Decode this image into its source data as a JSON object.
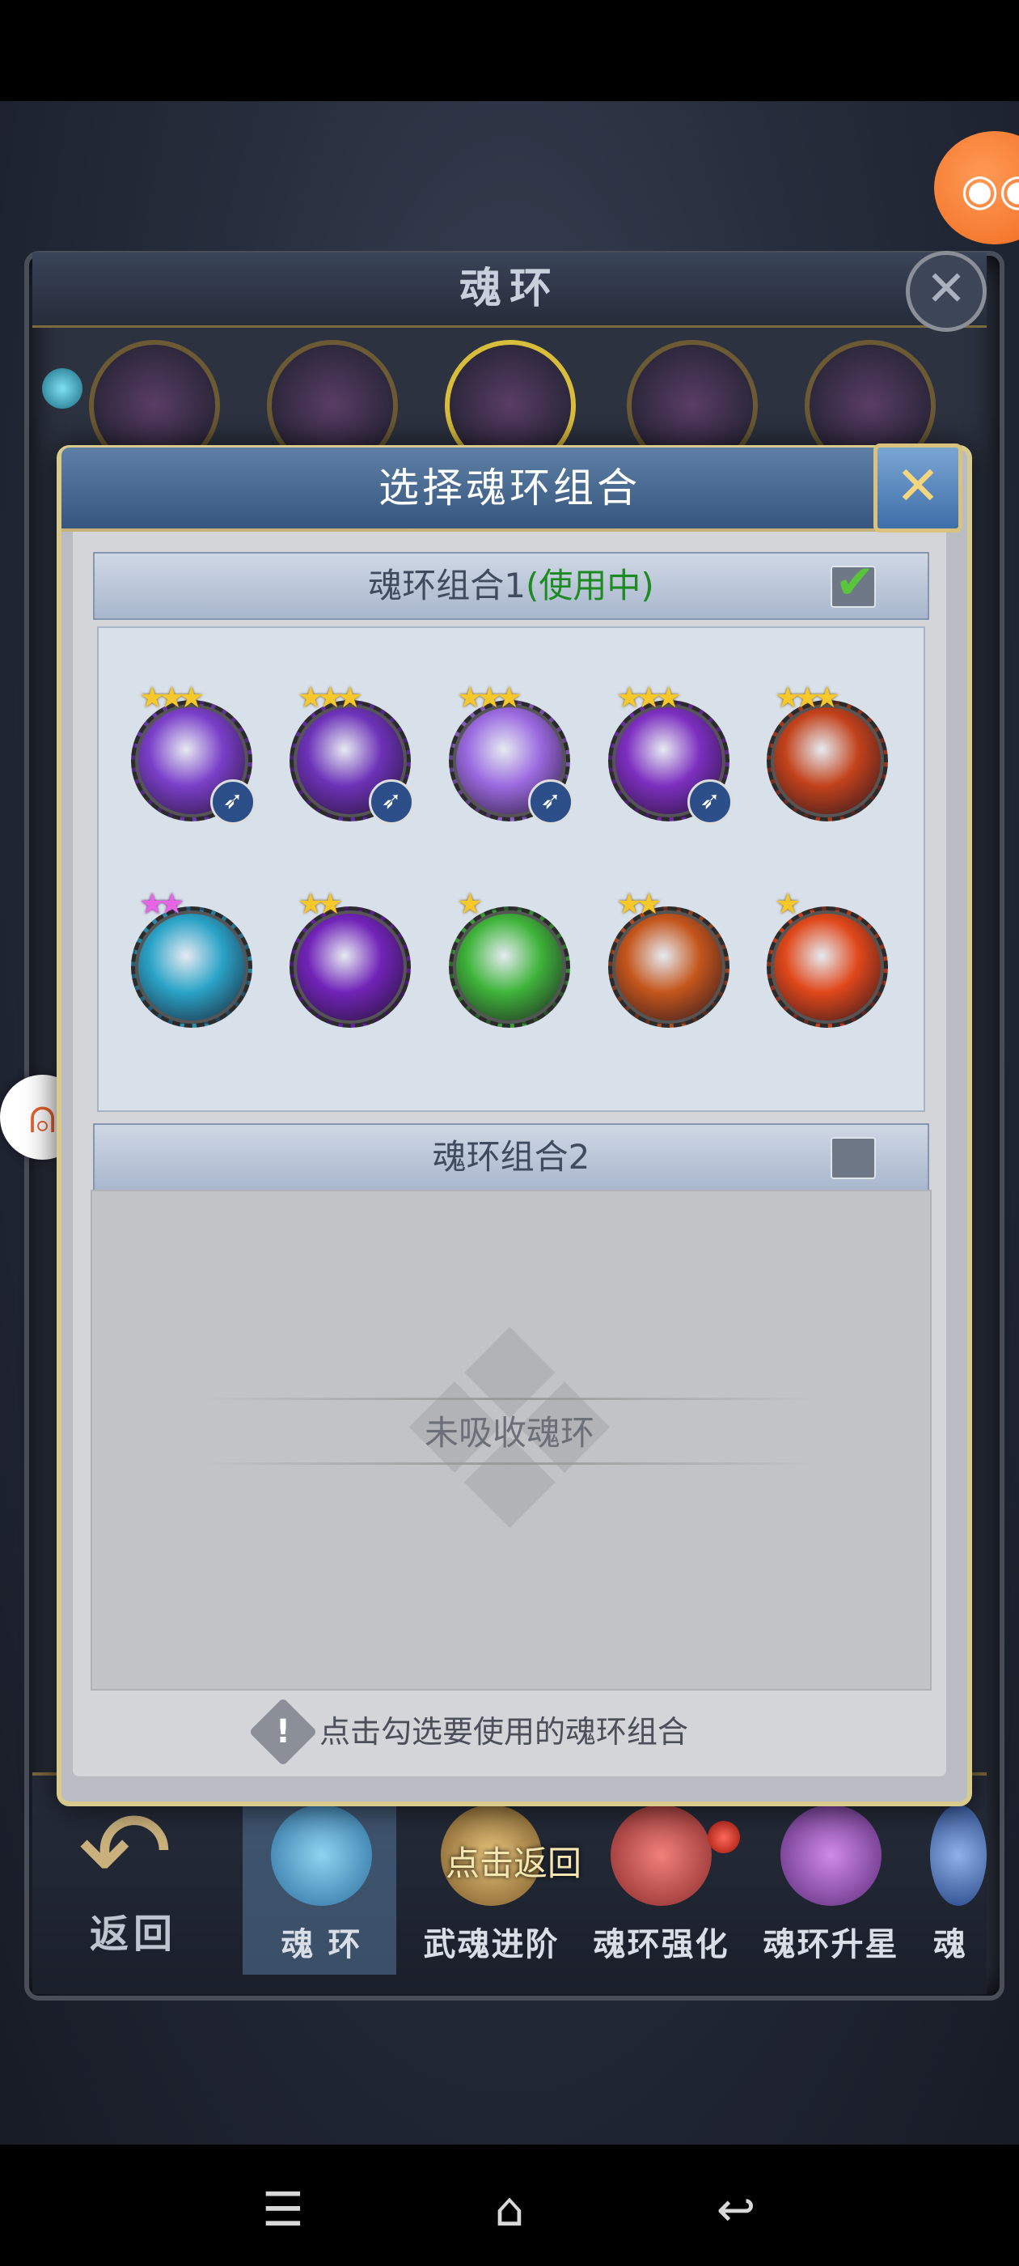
{
  "background_panel": {
    "title": "魂环",
    "close_icon": "close-icon",
    "back_label": "返回",
    "tabs": [
      {
        "label": "魂 环",
        "active": true
      },
      {
        "label": "武魂进阶"
      },
      {
        "label": "魂环强化"
      },
      {
        "label": "魂环升星"
      },
      {
        "label": "魂"
      }
    ],
    "click_back_hint": "点击返回"
  },
  "modal": {
    "title": "选择魂环组合",
    "close_icon": "close-icon",
    "set1": {
      "label": "魂环组合1",
      "status": "(使用中)",
      "checked": true,
      "rings": [
        {
          "stars": "★★★",
          "star_color": "gold",
          "badge": "➶",
          "color": "#7a3fc9"
        },
        {
          "stars": "★★★",
          "star_color": "gold",
          "badge": "➶",
          "color": "#6d32b8"
        },
        {
          "stars": "★★★",
          "star_color": "gold",
          "badge": "➶",
          "color": "#9b6ae0"
        },
        {
          "stars": "★★★",
          "star_color": "gold",
          "badge": "➶",
          "color": "#7d2fc0"
        },
        {
          "stars": "★★★",
          "star_color": "gold",
          "badge": "",
          "color": "#c2421b"
        },
        {
          "stars": "★★",
          "star_color": "pink",
          "badge": "",
          "color": "#2aa3c7"
        },
        {
          "stars": "★★",
          "star_color": "gold",
          "badge": "",
          "color": "#7124b8"
        },
        {
          "stars": "★",
          "star_color": "gold",
          "badge": "",
          "color": "#3fb43a"
        },
        {
          "stars": "★★",
          "star_color": "gold",
          "badge": "",
          "color": "#c4561c"
        },
        {
          "stars": "★",
          "star_color": "gold",
          "badge": "",
          "color": "#e0481a"
        }
      ]
    },
    "set2": {
      "label": "魂环组合2",
      "checked": false,
      "empty_text": "未吸收魂环"
    },
    "footer_hint": "点击勾选要使用的魂环组合"
  }
}
